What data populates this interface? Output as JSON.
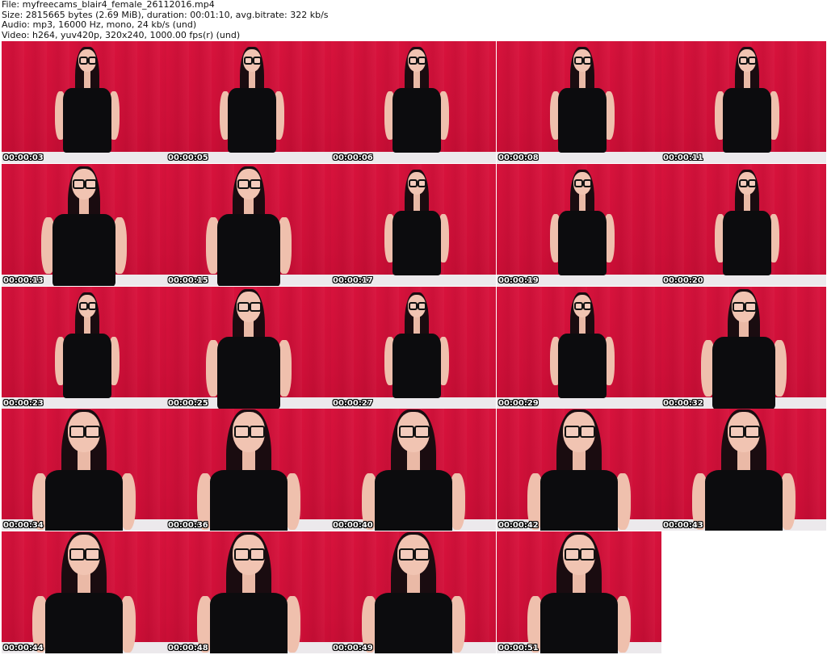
{
  "header": {
    "file": "File: myfreecams_blair4_female_26112016.mp4",
    "size": "Size: 2815665 bytes (2.69 MiB), duration: 00:01:10, avg.bitrate: 322 kb/s",
    "audio": "Audio: mp3, 16000 Hz, mono, 24 kb/s (und)",
    "video": "Video: h264, yuv420p, 320x240, 1000.00 fps(r) (und)"
  },
  "colors": {
    "backdrop": "#d8123c",
    "floor": "#ece9ec",
    "timestamp_text": "#ffffff",
    "timestamp_outline": "#000000"
  },
  "thumbnails": [
    {
      "time": "00:00:03",
      "pose": "wide"
    },
    {
      "time": "00:00:05",
      "pose": "wide"
    },
    {
      "time": "00:00:06",
      "pose": "wide"
    },
    {
      "time": "00:00:08",
      "pose": "wide"
    },
    {
      "time": "00:00:11",
      "pose": "wide"
    },
    {
      "time": "00:00:13",
      "pose": "mid"
    },
    {
      "time": "00:00:15",
      "pose": "mid"
    },
    {
      "time": "00:00:17",
      "pose": "wide"
    },
    {
      "time": "00:00:19",
      "pose": "wide"
    },
    {
      "time": "00:00:20",
      "pose": "wide"
    },
    {
      "time": "00:00:23",
      "pose": "wide"
    },
    {
      "time": "00:00:25",
      "pose": "mid"
    },
    {
      "time": "00:00:27",
      "pose": "wide"
    },
    {
      "time": "00:00:29",
      "pose": "wide"
    },
    {
      "time": "00:00:32",
      "pose": "mid"
    },
    {
      "time": "00:00:34",
      "pose": "close"
    },
    {
      "time": "00:00:36",
      "pose": "close"
    },
    {
      "time": "00:00:40",
      "pose": "close"
    },
    {
      "time": "00:00:42",
      "pose": "close"
    },
    {
      "time": "00:00:43",
      "pose": "close"
    },
    {
      "time": "00:00:44",
      "pose": "close"
    },
    {
      "time": "00:00:48",
      "pose": "close"
    },
    {
      "time": "00:00:49",
      "pose": "close"
    },
    {
      "time": "00:00:51",
      "pose": "close"
    }
  ]
}
